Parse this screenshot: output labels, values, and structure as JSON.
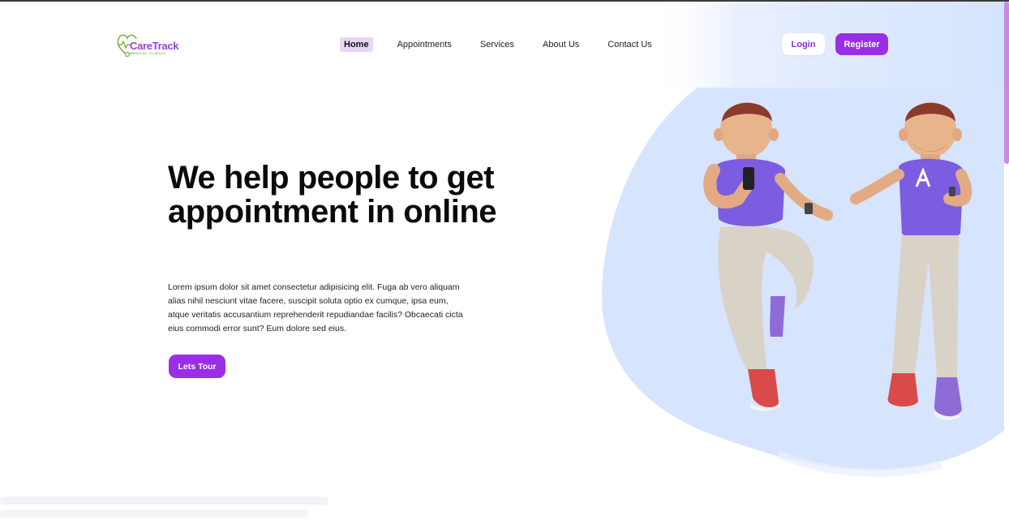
{
  "brand": {
    "name": "CareTrack",
    "tagline": "MEDICAL CLINICS",
    "colors": {
      "primary": "#9a2ee6",
      "accent_green": "#7cb342",
      "blob": "#d4e3fd"
    }
  },
  "nav": {
    "items": [
      {
        "label": "Home",
        "active": true
      },
      {
        "label": "Appointments"
      },
      {
        "label": "Services"
      },
      {
        "label": "About Us"
      },
      {
        "label": "Contact Us"
      }
    ]
  },
  "auth": {
    "login_label": "Login",
    "register_label": "Register"
  },
  "hero": {
    "title": "We help people to get appointment in online",
    "body": "Lorem ipsum dolor sit amet consectetur adipisicing elit. Fuga ab vero aliquam alias nihil nesciunt vitae facere, suscipit soluta optio ex cumque, ipsa eum, atque veritatis accusantium reprehenderit repudiandae facilis? Obcaecati cicta eius commodi error sunt? Eum dolore sed eius.",
    "cta_label": "Lets Tour"
  },
  "icons": {
    "logo": "heart-stethoscope-icon",
    "illustration": "two-people-illustration"
  }
}
